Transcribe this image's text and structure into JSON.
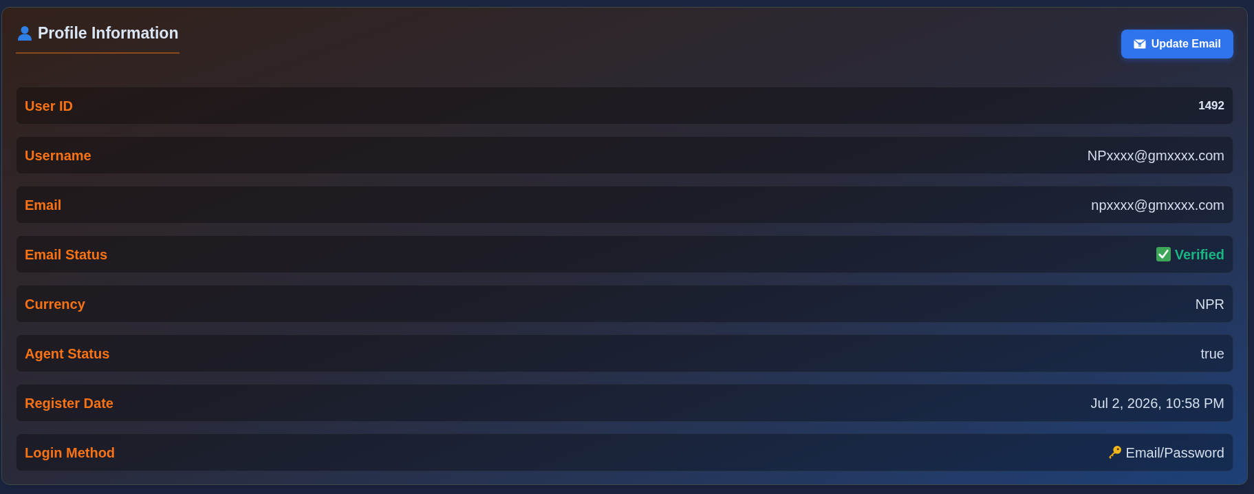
{
  "card": {
    "title": "Profile Information",
    "button": {
      "label": "Update Email"
    },
    "rows": [
      {
        "label": "User ID",
        "value": "1492",
        "kind": "strong"
      },
      {
        "label": "Username",
        "value": "NPxxxx@gmxxxx.com",
        "kind": "plain"
      },
      {
        "label": "Email",
        "value": "npxxxx@gmxxxx.com",
        "kind": "plain"
      },
      {
        "label": "Email Status",
        "value": "Verified",
        "kind": "status"
      },
      {
        "label": "Currency",
        "value": "NPR",
        "kind": "plain"
      },
      {
        "label": "Agent Status",
        "value": "true",
        "kind": "plain"
      },
      {
        "label": "Register Date",
        "value": "Jul 2, 2026, 10:58 PM",
        "kind": "plain"
      },
      {
        "label": "Login Method",
        "value": "Email/Password",
        "kind": "method"
      }
    ]
  }
}
